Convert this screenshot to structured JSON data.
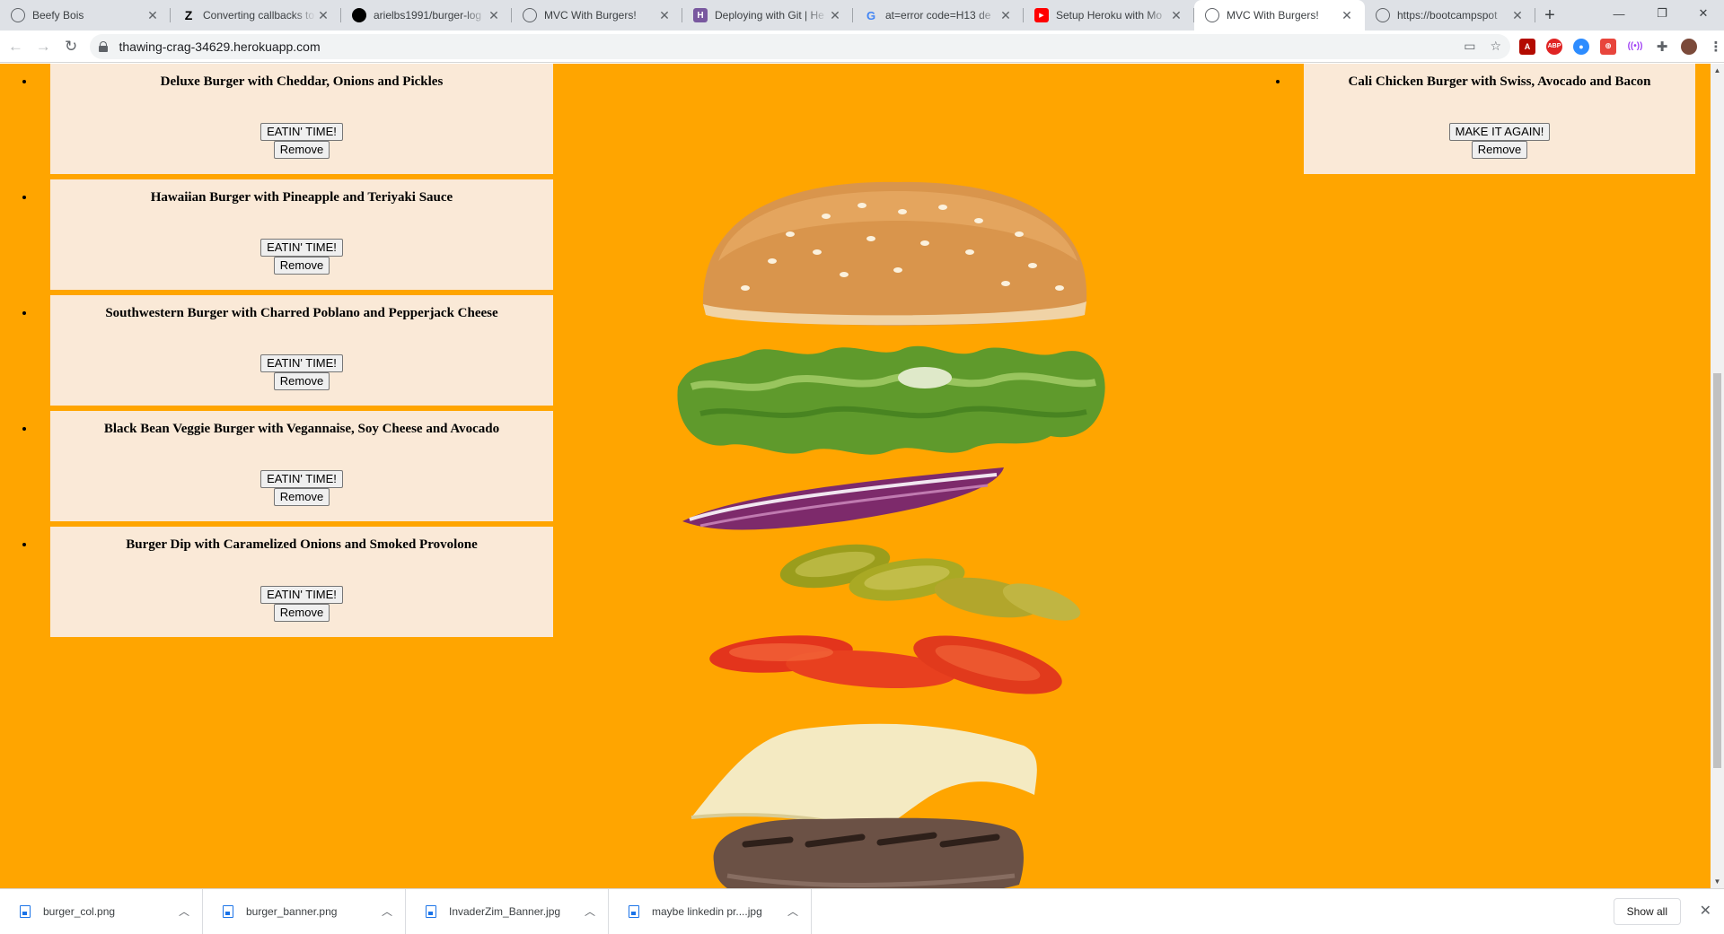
{
  "browser": {
    "tabs": [
      {
        "title": "Beefy Bois",
        "favicon": "globe-icon",
        "active": false
      },
      {
        "title": "Converting callbacks to",
        "favicon": "zapier-z-icon",
        "active": false
      },
      {
        "title": "arielbs1991/burger-log",
        "favicon": "github-icon",
        "active": false
      },
      {
        "title": "MVC With Burgers!",
        "favicon": "globe-icon",
        "active": false
      },
      {
        "title": "Deploying with Git | He",
        "favicon": "heroku-icon",
        "active": false
      },
      {
        "title": "at=error code=H13 de",
        "favicon": "google-icon",
        "active": false
      },
      {
        "title": "Setup Heroku with Mo",
        "favicon": "youtube-icon",
        "active": false
      },
      {
        "title": "MVC With Burgers!",
        "favicon": "globe-icon",
        "active": true
      },
      {
        "title": "https://bootcampspot",
        "favicon": "globe-icon",
        "active": false
      }
    ],
    "new_tab_label": "+",
    "url": "thawing-crag-34629.herokuapp.com"
  },
  "page": {
    "background_color": "#ffa500",
    "card_color": "#fae9d7",
    "uneaten": [
      {
        "name": "Deluxe Burger with Cheddar, Onions and Pickles",
        "eat_label": "EATIN' TIME!",
        "remove_label": "Remove"
      },
      {
        "name": "Hawaiian Burger with Pineapple and Teriyaki Sauce",
        "eat_label": "EATIN' TIME!",
        "remove_label": "Remove"
      },
      {
        "name": "Southwestern Burger with Charred Poblano and Pepperjack Cheese",
        "eat_label": "EATIN' TIME!",
        "remove_label": "Remove"
      },
      {
        "name": "Black Bean Veggie Burger with Vegannaise, Soy Cheese and Avocado",
        "eat_label": "EATIN' TIME!",
        "remove_label": "Remove"
      },
      {
        "name": "Burger Dip with Caramelized Onions and Smoked Provolone",
        "eat_label": "EATIN' TIME!",
        "remove_label": "Remove"
      }
    ],
    "devoured": [
      {
        "name": "Cali Chicken Burger with Swiss, Avocado and Bacon",
        "again_label": "MAKE IT AGAIN!",
        "remove_label": "Remove"
      }
    ],
    "illustration": "exploded-burger-illustration"
  },
  "downloads": {
    "files": [
      "burger_col.png",
      "burger_banner.png",
      "InvaderZim_Banner.jpg",
      "maybe linkedin pr....jpg"
    ],
    "show_all_label": "Show all"
  }
}
